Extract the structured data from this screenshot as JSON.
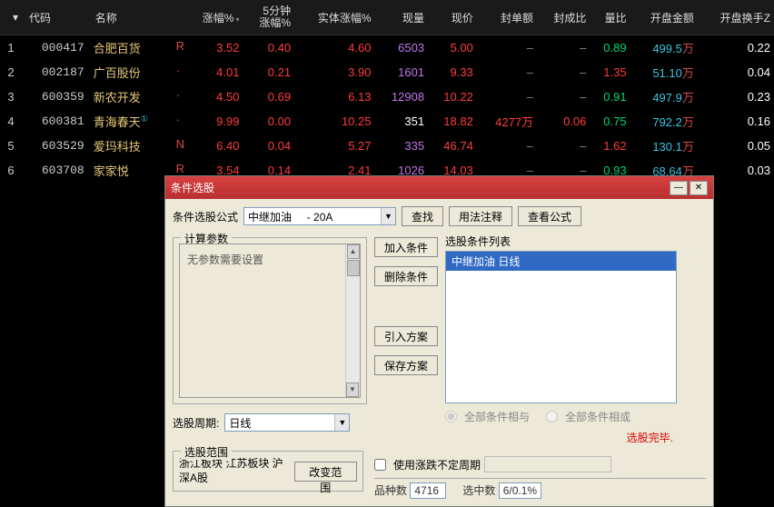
{
  "headers": {
    "idx": "",
    "code": "代码",
    "name": "名称",
    "chg": "涨幅%",
    "chg5": "5分钟\n涨幅%",
    "real": "实体涨幅%",
    "vol": "现量",
    "price": "现价",
    "seal": "封单额",
    "sealr": "封成比",
    "volr": "量比",
    "openamt": "开盘金额",
    "openturn": "开盘换手Z"
  },
  "rows": [
    {
      "i": "1",
      "code": "000417",
      "name": "合肥百货",
      "flag": "R",
      "chg": "3.52",
      "chg5": "0.40",
      "real": "4.60",
      "vol": "6503",
      "price": "5.00",
      "seal": "–",
      "sealr": "–",
      "volr": "0.89",
      "openamt": "499.5",
      "openturn": "0.22"
    },
    {
      "i": "2",
      "code": "002187",
      "name": "广百股份",
      "flag": "·",
      "chg": "4.01",
      "chg5": "0.21",
      "real": "3.90",
      "vol": "1601",
      "price": "9.33",
      "seal": "–",
      "sealr": "–",
      "volr": "1.35",
      "openamt": "51.10",
      "openturn": "0.04"
    },
    {
      "i": "3",
      "code": "600359",
      "name": "新农开发",
      "flag": "·",
      "chg": "4.50",
      "chg5": "0.69",
      "real": "6.13",
      "vol": "12908",
      "price": "10.22",
      "seal": "–",
      "sealr": "–",
      "volr": "0.91",
      "openamt": "497.9",
      "openturn": "0.23"
    },
    {
      "i": "4",
      "code": "600381",
      "name": "青海春天",
      "flag": "·",
      "sup": "①",
      "chg": "9.99",
      "chg5": "0.00",
      "real": "10.25",
      "vol": "351",
      "volw": true,
      "price": "18.82",
      "seal": "4277万",
      "sealr": "0.06",
      "volr": "0.75",
      "openamt": "792.2",
      "openturn": "0.16"
    },
    {
      "i": "5",
      "code": "603529",
      "name": "爱玛科技",
      "flag": "N",
      "chg": "6.40",
      "chg5": "0.04",
      "real": "5.27",
      "vol": "335",
      "price": "46.74",
      "seal": "–",
      "sealr": "–",
      "volr": "1.62",
      "openamt": "130.1",
      "openturn": "0.05"
    },
    {
      "i": "6",
      "code": "603708",
      "name": "家家悦",
      "flag": "R",
      "chg": "3.54",
      "chg5": "0.14",
      "real": "2.41",
      "vol": "1026",
      "price": "14.03",
      "seal": "–",
      "sealr": "–",
      "volr": "0.93",
      "openamt": "68.64",
      "openturn": "0.03"
    }
  ],
  "unit": "万",
  "dialog": {
    "title": "条件选股",
    "formula_label": "条件选股公式",
    "formula_value": "中继加油     - 20A",
    "find": "查找",
    "usage": "用法注释",
    "view": "查看公式",
    "calc_legend": "计算参数",
    "calc_text": "无参数需要设置",
    "add": "加入条件",
    "del": "删除条件",
    "import": "引入方案",
    "save": "保存方案",
    "list_label": "选股条件列表",
    "list_item": "中继加油  日线",
    "period_label": "选股周期:",
    "period_value": "日线",
    "radio_and": "全部条件相与",
    "radio_or": "全部条件相或",
    "done": "选股完毕.",
    "range_legend": "选股范围",
    "range_text": "浙江板块 江苏板块 沪深A股",
    "range_btn": "改变范围",
    "use_chg": "使用涨跌不定周期",
    "count_label": "品种数",
    "count_val": "4716",
    "sel_label": "选中数",
    "sel_val": "6/0.1%"
  }
}
